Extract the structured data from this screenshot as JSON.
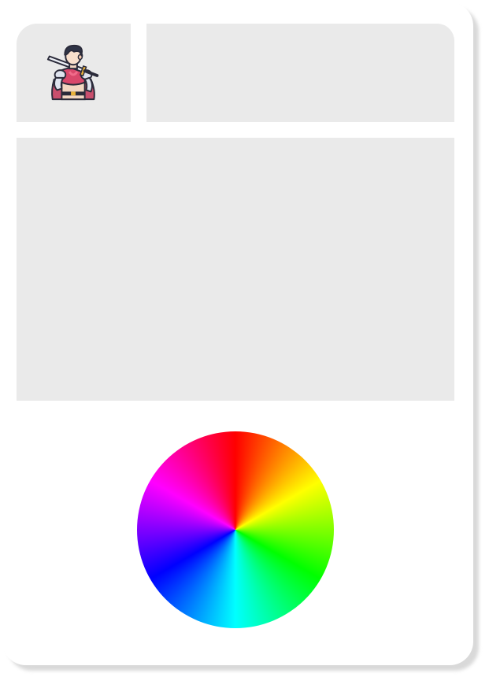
{
  "icons": {
    "avatar": "knight-with-sword-icon"
  },
  "colors": {
    "panel_background": "#eaeaea",
    "card_background": "#ffffff",
    "card_shadow": "#d9d9d9"
  },
  "color_wheel": {
    "type": "hue-wheel",
    "hue_stops": [
      "#ff0000",
      "#ffff00",
      "#00ff00",
      "#00ffff",
      "#0000ff",
      "#ff00ff",
      "#ff0000"
    ]
  }
}
